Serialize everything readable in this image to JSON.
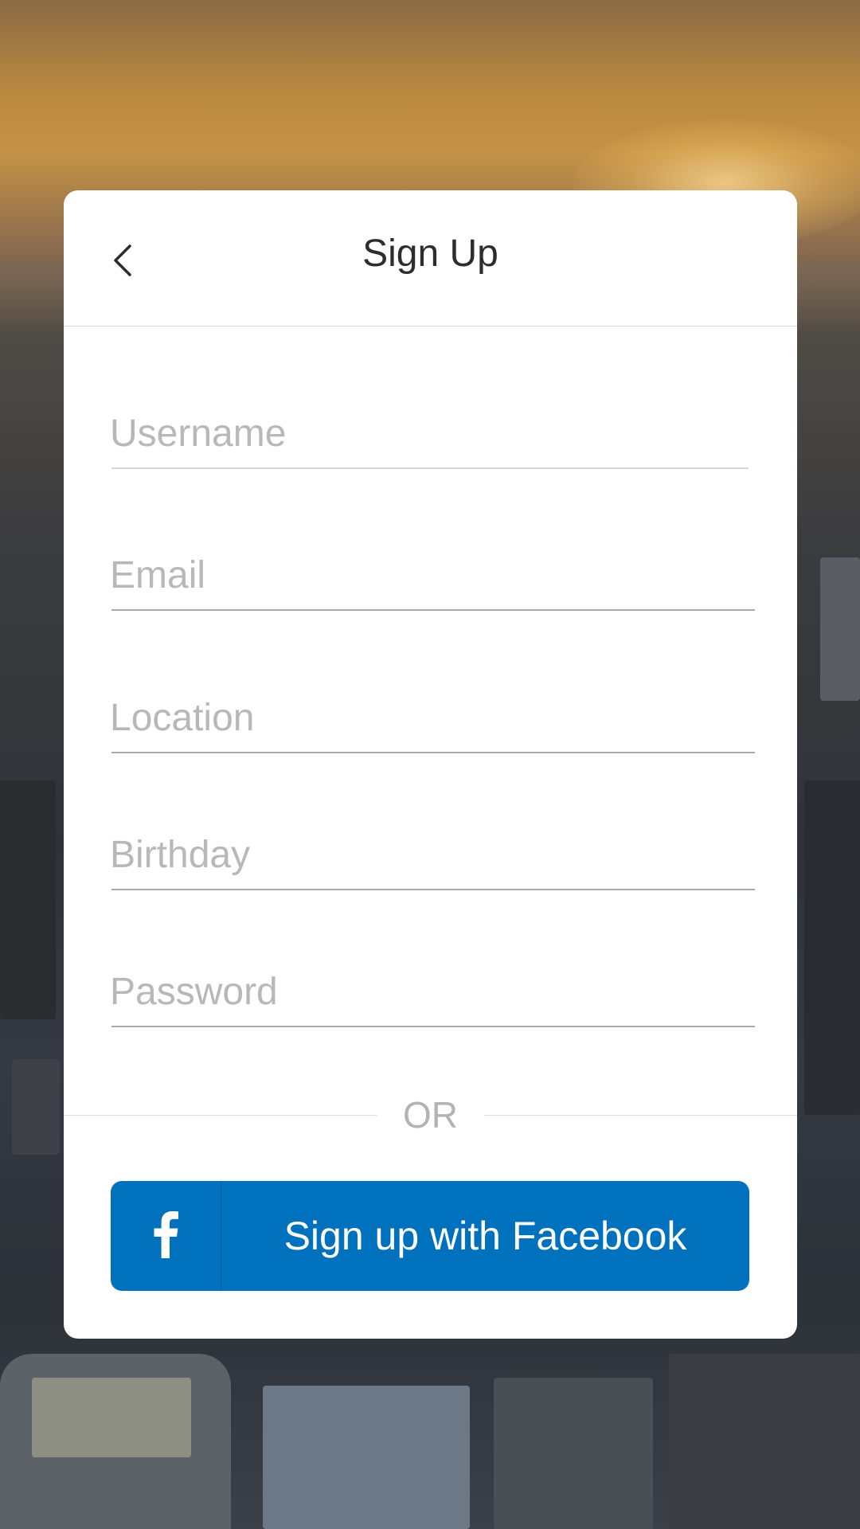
{
  "header": {
    "title": "Sign Up",
    "back_icon": "chevron-left-icon"
  },
  "form": {
    "fields": [
      {
        "name": "username",
        "placeholder": "Username",
        "value": ""
      },
      {
        "name": "email",
        "placeholder": "Email",
        "value": ""
      },
      {
        "name": "location",
        "placeholder": "Location",
        "value": ""
      },
      {
        "name": "birthday",
        "placeholder": "Birthday",
        "value": ""
      },
      {
        "name": "password",
        "placeholder": "Password",
        "value": ""
      }
    ]
  },
  "divider": {
    "label": "OR"
  },
  "facebook": {
    "icon": "facebook-icon",
    "label": "Sign up with Facebook",
    "color": "#0071bc"
  },
  "colors": {
    "card": "#ffffff",
    "placeholder": "#b8b8b8",
    "title": "#2d2d2d"
  }
}
